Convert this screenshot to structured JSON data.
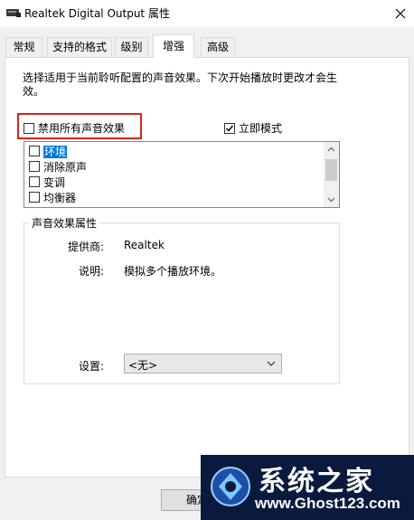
{
  "window": {
    "title": "Realtek Digital Output 属性",
    "close_icon": "close-icon"
  },
  "tabs": [
    {
      "label": "常规",
      "active": false
    },
    {
      "label": "支持的格式",
      "active": false
    },
    {
      "label": "级别",
      "active": false
    },
    {
      "label": "增强",
      "active": true
    },
    {
      "label": "高级",
      "active": false
    }
  ],
  "enhancements": {
    "description": "选择适用于当前聆听配置的声音效果。下次开始播放时更改才会生效。",
    "disable_all": {
      "label": "禁用所有声音效果",
      "checked": false
    },
    "immediate_mode": {
      "label": "立即模式",
      "checked": true
    },
    "effects": [
      {
        "label": "环境",
        "checked": false,
        "selected": true
      },
      {
        "label": "消除原声",
        "checked": false,
        "selected": false
      },
      {
        "label": "变调",
        "checked": false,
        "selected": false
      },
      {
        "label": "均衡器",
        "checked": false,
        "selected": false
      }
    ],
    "properties": {
      "group_title": "声音效果属性",
      "provider_label": "提供商:",
      "provider_value": "Realtek",
      "description_label": "说明:",
      "description_value": "模拟多个播放环境。",
      "setting_label": "设置:",
      "setting_value": "<无>"
    }
  },
  "buttons": {
    "ok": "确定"
  },
  "watermark": {
    "title": "系统之家",
    "url": "www.Ghost123.com"
  },
  "colors": {
    "selection": "#0078d7",
    "highlight_border": "#e02020"
  }
}
